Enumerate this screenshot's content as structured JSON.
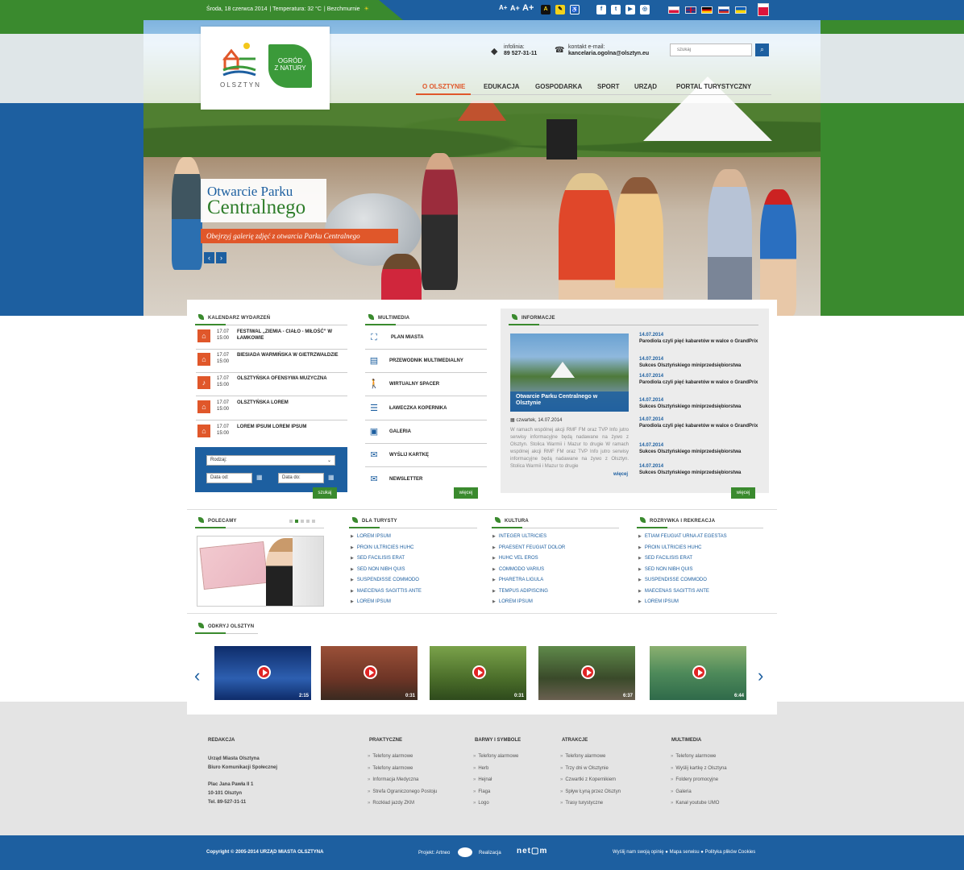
{
  "topbar": {
    "date": "Środa, 18 czerwca 2014",
    "temperature": "Temperatura: 32 °C",
    "weather": "Bezchmurnie",
    "font_small": "A+",
    "font_medium": "A+",
    "font_large": "A+",
    "contrast_label": "A"
  },
  "header": {
    "logo_text": "OLSZTYN",
    "ogrod_line1": "OGRÓD",
    "ogrod_line2": "Z NATURY",
    "infolinia_label": "infolinia:",
    "infolinia_number": "89 527-31-11",
    "email_label": "kontakt e-mail:",
    "email_value": "kancelaria.ogolna@olsztyn.eu",
    "search_placeholder": "szukaj"
  },
  "nav": [
    "O OLSZTYNIE",
    "EDUKACJA",
    "GOSPODARKA",
    "SPORT",
    "URZĄD",
    "PORTAL TURYSTYCZNY"
  ],
  "slide": {
    "title1": "Otwarcie Parku",
    "title2": "Centralnego",
    "subtitle": "Obejrzyj galerię zdjęć z otwarcia Parku Centralnego"
  },
  "calendar": {
    "title": "KALENDARZ WYDARZEŃ",
    "items": [
      {
        "date": "17.07",
        "time": "15:00",
        "title": "FESTIWAL „ZIEMIA - CIAŁO - MIŁOŚĆ” W ŁAMKOWIE"
      },
      {
        "date": "17.07",
        "time": "15:00",
        "title": "BIESIADA WARMIŃSKA W GIETRZWAŁDZIE"
      },
      {
        "date": "17.07",
        "time": "15:00",
        "title": "OLSZTYŃSKA OFENSYWA MUZYCZNA"
      },
      {
        "date": "17.07",
        "time": "15:00",
        "title": "OLSZTYŃSKA LOREM"
      },
      {
        "date": "17.07",
        "time": "15:00",
        "title": "LOREM IPSUM LOREM IPSUM"
      }
    ],
    "filter": {
      "type_label": "Rodzaj:",
      "date_from": "Data od:",
      "date_to": "Data do:",
      "search_button": "szukaj"
    }
  },
  "multimedia": {
    "title": "MULTIMEDIA",
    "items": [
      "PLAN MIASTA",
      "PRZEWODNIK MULTIMEDIALNY",
      "WIRTUALNY SPACER",
      "ŁAWECZKA KOPERNIKA",
      "GALERIA",
      "WYŚLIJ KARTKĘ",
      "NEWSLETTER"
    ],
    "more": "więcej"
  },
  "informacje": {
    "title": "INFORMACJE",
    "featured_caption": "Otwarcie Parku Centralnego w Olsztynie",
    "featured_date": "czwartek, 14.07.2014",
    "featured_text": "W ramach wspólnej akcji RMF FM oraz TVP Info jutro serwisy informacyjne będą nadawane na żywo z Olsztyn. Stolica Warmii i Mazur to drugie W ramach wspólnej akcji RMF FM oraz TVP Info jutro serwisy informacyjne będą nadawane na żywo z Olsztyn. Stolica Warmii i Mazur to drugie",
    "featured_more": "więcej",
    "news": [
      {
        "date": "14.07.2014",
        "title": "Parodiola czyli pięć kabaretów w walce o GrandPrix"
      },
      {
        "date": "14.07.2014",
        "title": "Sukces Olsztyńskiego miniprzedsiębiorstwa"
      },
      {
        "date": "14.07.2014",
        "title": "Parodiola czyli pięć kabaretów w walce o GrandPrix"
      },
      {
        "date": "14.07.2014",
        "title": "Sukces Olsztyńskiego miniprzedsiębiorstwa"
      },
      {
        "date": "14.07.2014",
        "title": "Parodiola czyli pięć kabaretów w walce o GrandPrix"
      },
      {
        "date": "14.07.2014",
        "title": "Sukces Olsztyńskiego miniprzedsiębiorstwa"
      },
      {
        "date": "14.07.2014",
        "title": "Sukces Olsztyńskiego miniprzedsiębiorstwa"
      }
    ],
    "more": "więcej"
  },
  "polecamy": {
    "title": "POLECAMY"
  },
  "lists": [
    {
      "title": "DLA TURYSTY",
      "items": [
        "LOREM IPSUM",
        "PROIN ULTRICIES HUHC",
        "SED FACILISIS ERAT",
        "SED NON NIBH QUIS",
        "SUSPENDISSE COMMODO",
        "MAECENAS SAGITTIS ANTE",
        "LOREM IPSUM"
      ]
    },
    {
      "title": "KULTURA",
      "items": [
        "INTEGER ULTRICIES",
        "PRAESENT FEUGIAT DOLOR",
        "HUHC VEL EROS",
        "COMMODO VARIUS",
        "PHARETRA LIGULA",
        "TEMPUS ADIPISCING",
        "LOREM IPSUM"
      ]
    },
    {
      "title": "ROZRYWKA I REKREACJA",
      "items": [
        "ETIAM FEUGIAT URNA AT EGESTAS",
        "PROIN ULTRICIES HUHC",
        "SED FACILISIS ERAT",
        "SED NON NIBH QUIS",
        "SUSPENDISSE COMMODO",
        "MAECENAS SAGITTIS ANTE",
        "LOREM IPSUM"
      ]
    }
  ],
  "odkryj": {
    "title": "ODKRYJ OLSZTYN",
    "videos": [
      {
        "time": "2:15",
        "bg": "#1a3f8a"
      },
      {
        "time": "0:31",
        "bg": "#8a4a34"
      },
      {
        "time": "0:31",
        "bg": "#5e8a3a"
      },
      {
        "time": "6:37",
        "bg": "#4d6a3a"
      },
      {
        "time": "6:44",
        "bg": "#4b8a52"
      }
    ]
  },
  "footer": {
    "redakcja": {
      "title": "REDAKCJA",
      "lines": [
        "Urząd Miasta Olsztyna",
        "Biuro Komunikacji Społecznej",
        "Plac Jana Pawła II 1",
        "10-101 Olsztyn",
        "Tel. 89-527-31-11"
      ]
    },
    "columns": [
      {
        "title": "PRAKTYCZNE",
        "items": [
          "Telefony alarmowe",
          "Telefony alarmowe",
          "Informacja Medyczna",
          "Strefa Ograniczonego Postoju",
          "Rozkład jazdy ZKM"
        ]
      },
      {
        "title": "BARWY I SYMBOLE",
        "items": [
          "Telefony alarmowe",
          "Herb",
          "Hejnał",
          "Flaga",
          "Logo"
        ]
      },
      {
        "title": "ATRAKCJE",
        "items": [
          "Telefony alarmowe",
          "Trzy dni w Olsztynie",
          "Czwartki z Kopernikiem",
          "Spływ Łyną przez Olsztyn",
          "Trasy turystyczne"
        ]
      },
      {
        "title": "MULTIMEDIA",
        "items": [
          "Telefony alarmowe",
          "Wyślij kartkę z Olsztyna",
          "Foldery promocyjne",
          "Galeria",
          "Kanał youtube UMO"
        ]
      }
    ],
    "copyright": "Copyright © 2005-2014 URZĄD MIASTA OLSZTYNA",
    "projekt": "Projekt: Artneo",
    "realizacja": "Realizacja",
    "links": "Wyślij nam swoją opinię ● Mapa serwisu ● Polityka plików Cookies"
  },
  "colors": {
    "blue": "#1d5fa0",
    "green": "#3a8a2e",
    "orange": "#e0572a"
  }
}
